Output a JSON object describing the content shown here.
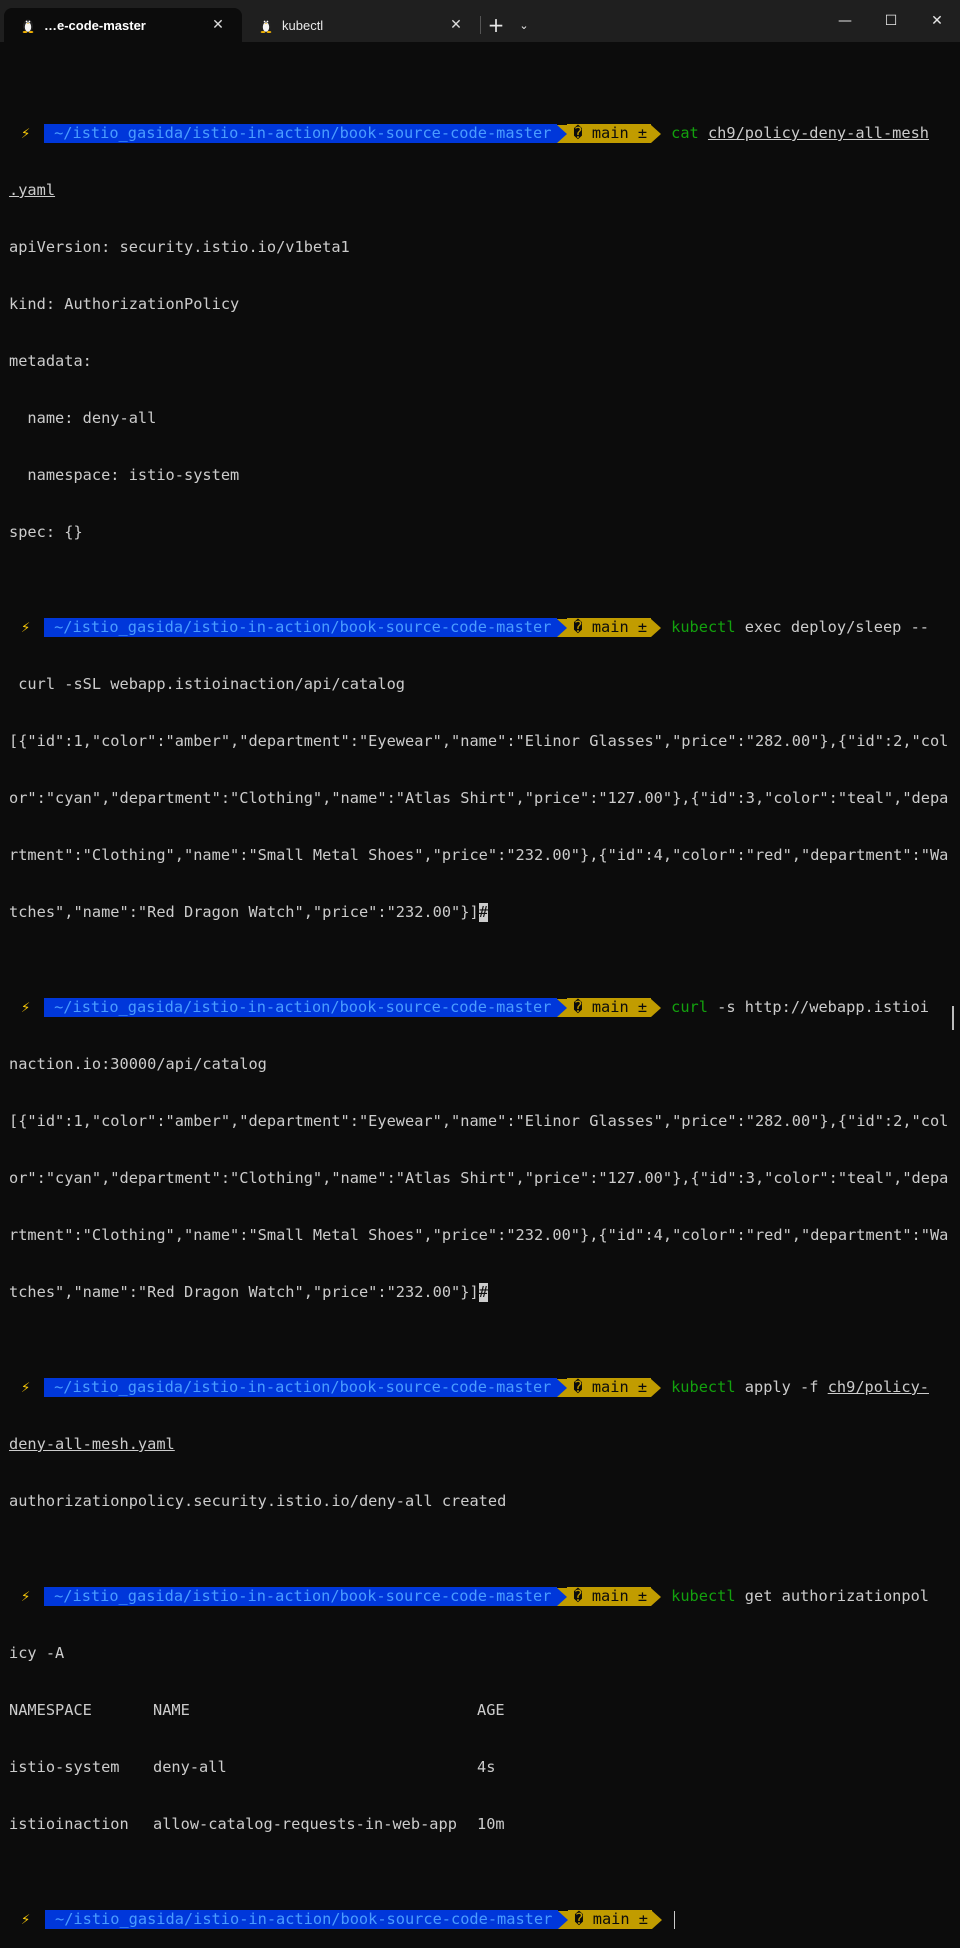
{
  "window": {
    "tabs": [
      {
        "label": "…e-code-master",
        "icon": "linux-penguin-icon",
        "active": true
      },
      {
        "label": "kubectl",
        "icon": "linux-penguin-icon",
        "active": false
      }
    ],
    "new_tab_glyph": "+",
    "dropdown_glyph": "⌄",
    "close_glyph": "✕",
    "minimize_glyph": "—",
    "maximize_glyph": "☐",
    "window_close_glyph": "✕"
  },
  "prompt": {
    "bolt": "⚡",
    "path": "~/istio_gasida/istio-in-action/book-source-code-master",
    "git": "� main ±"
  },
  "blocks": {
    "b1": {
      "cmd_name": "cat",
      "cmd_arg": "ch9/policy-deny-all-mesh",
      "cmd_wrap": ".yaml",
      "out": [
        "apiVersion: security.istio.io/v1beta1",
        "kind: AuthorizationPolicy",
        "metadata:",
        "  name: deny-all",
        "  namespace: istio-system",
        "spec: {}"
      ]
    },
    "b2": {
      "cmd_name": "kubectl",
      "cmd_rest": "exec deploy/sleep --",
      "cmd_wrap": " curl -sSL webapp.istioinaction/api/catalog",
      "out": [
        "[{\"id\":1,\"color\":\"amber\",\"department\":\"Eyewear\",\"name\":\"Elinor Glasses\",\"price\":\"282.00\"},{\"id\":2,\"col",
        "or\":\"cyan\",\"department\":\"Clothing\",\"name\":\"Atlas Shirt\",\"price\":\"127.00\"},{\"id\":3,\"color\":\"teal\",\"depa",
        "rtment\":\"Clothing\",\"name\":\"Small Metal Shoes\",\"price\":\"232.00\"},{\"id\":4,\"color\":\"red\",\"department\":\"Wa",
        "tches\",\"name\":\"Red Dragon Watch\",\"price\":\"232.00\"}]"
      ],
      "eol_mark": "#"
    },
    "b3": {
      "cmd_name": "curl",
      "cmd_rest": "-s http://webapp.istioi",
      "cmd_wrap": "naction.io:30000/api/catalog",
      "out": [
        "[{\"id\":1,\"color\":\"amber\",\"department\":\"Eyewear\",\"name\":\"Elinor Glasses\",\"price\":\"282.00\"},{\"id\":2,\"col",
        "or\":\"cyan\",\"department\":\"Clothing\",\"name\":\"Atlas Shirt\",\"price\":\"127.00\"},{\"id\":3,\"color\":\"teal\",\"depa",
        "rtment\":\"Clothing\",\"name\":\"Small Metal Shoes\",\"price\":\"232.00\"},{\"id\":4,\"color\":\"red\",\"department\":\"Wa",
        "tches\",\"name\":\"Red Dragon Watch\",\"price\":\"232.00\"}]"
      ],
      "eol_mark": "#"
    },
    "b4": {
      "cmd_name": "kubectl",
      "cmd_rest": "apply -f",
      "cmd_arg": "ch9/policy-",
      "cmd_wrap": "deny-all-mesh.yaml",
      "out": [
        "authorizationpolicy.security.istio.io/deny-all created"
      ]
    },
    "b5": {
      "cmd_name": "kubectl",
      "cmd_rest": "get authorizationpol",
      "cmd_wrap": "icy -A",
      "table": {
        "headers": [
          "NAMESPACE",
          "NAME",
          "AGE"
        ],
        "rows": [
          [
            "istio-system",
            "deny-all",
            "4s"
          ],
          [
            "istioinaction",
            "allow-catalog-requests-in-web-app",
            "10m"
          ]
        ]
      }
    }
  },
  "colors": {
    "background": "#0c0c0c",
    "path_segment": "#0037da",
    "git_segment": "#c19c00",
    "command_green": "#13a10e",
    "text": "#cccccc"
  }
}
